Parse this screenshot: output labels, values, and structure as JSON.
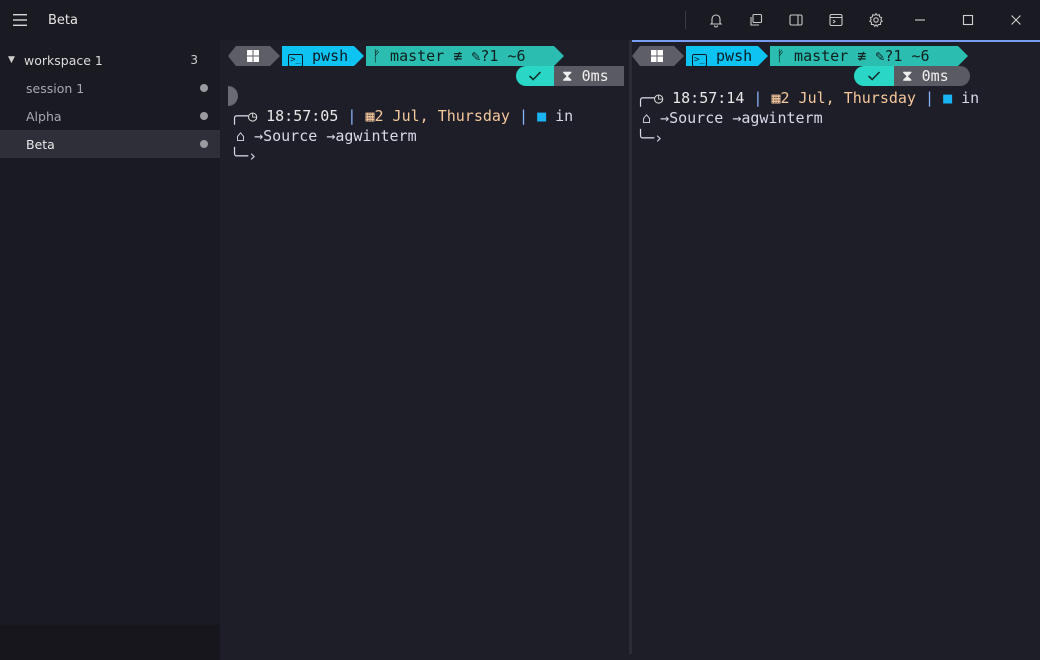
{
  "window": {
    "title": "Beta",
    "icons": [
      "menu-icon",
      "bell-icon",
      "windows-icon",
      "panel-icon",
      "terminal-box-icon",
      "gear-icon",
      "minimize-icon",
      "maximize-icon",
      "close-icon"
    ]
  },
  "sidebar": {
    "workspace": {
      "name": "workspace 1",
      "count": "3"
    },
    "sessions": [
      {
        "label": "session 1",
        "active": false
      },
      {
        "label": "Alpha",
        "active": false
      },
      {
        "label": "Beta",
        "active": true
      }
    ]
  },
  "panes": [
    {
      "prompt": {
        "shell": "pwsh",
        "branch": "master",
        "git_status": "≢",
        "changes": "?1 ~6",
        "duration": "0ms",
        "time": "18:57:05",
        "date": "2 Jul, Thursday",
        "in_label": "in",
        "path_segments": [
          "Source",
          "agwinterm"
        ]
      }
    },
    {
      "prompt": {
        "shell": "pwsh",
        "branch": "master",
        "git_status": "≢",
        "changes": "?1 ~6",
        "duration": "0ms",
        "time": "18:57:14",
        "date": "2 Jul, Thursday",
        "in_label": "in",
        "path_segments": [
          "Source",
          "agwinterm"
        ]
      }
    }
  ],
  "colors": {
    "accent": "#7a9cf0",
    "shell_segment": "#0dc3f2",
    "git_segment": "#2bbdb0",
    "ok_segment": "#2ad6c6",
    "date": "#f5c89c",
    "folder": "#19b4f2"
  }
}
